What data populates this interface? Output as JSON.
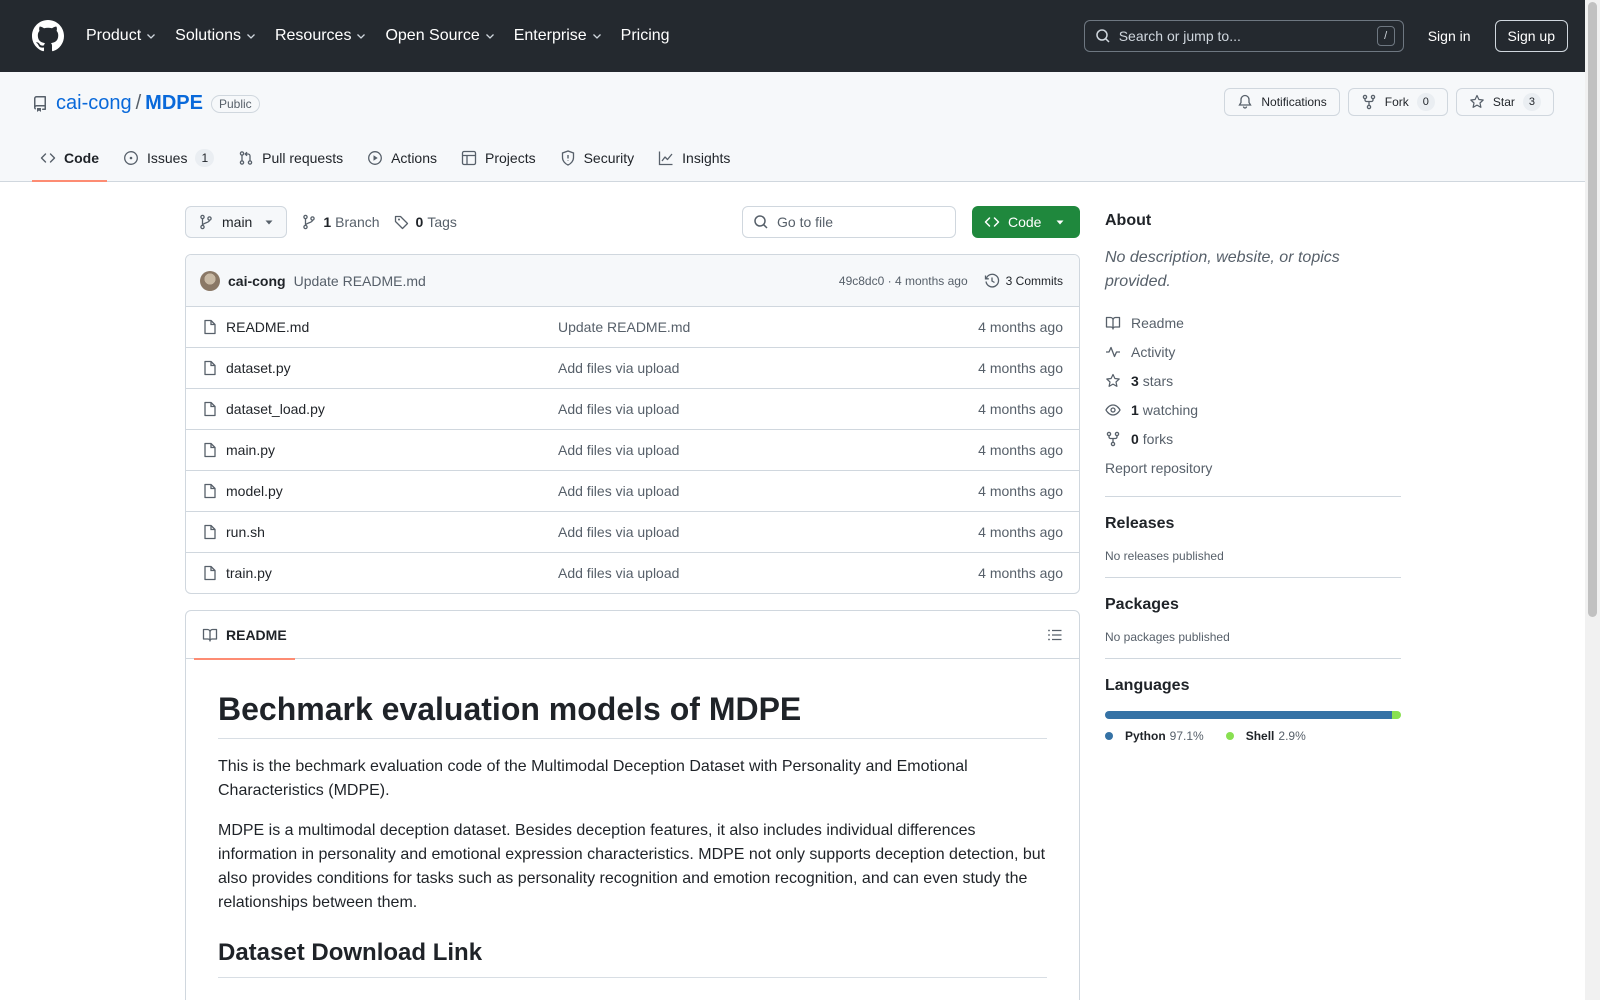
{
  "header": {
    "nav": [
      "Product",
      "Solutions",
      "Resources",
      "Open Source",
      "Enterprise",
      "Pricing"
    ],
    "search_placeholder": "Search or jump to...",
    "search_shortcut": "/",
    "sign_in": "Sign in",
    "sign_up": "Sign up"
  },
  "repo": {
    "owner": "cai-cong",
    "separator": "/",
    "name": "MDPE",
    "visibility": "Public",
    "notifications_label": "Notifications",
    "fork_label": "Fork",
    "fork_count": "0",
    "star_label": "Star",
    "star_count": "3"
  },
  "tabs": [
    {
      "label": "Code",
      "icon": "code-icon"
    },
    {
      "label": "Issues",
      "icon": "issue-icon",
      "count": "1"
    },
    {
      "label": "Pull requests",
      "icon": "pull-request-icon"
    },
    {
      "label": "Actions",
      "icon": "play-icon"
    },
    {
      "label": "Projects",
      "icon": "table-icon"
    },
    {
      "label": "Security",
      "icon": "shield-icon"
    },
    {
      "label": "Insights",
      "icon": "graph-icon"
    }
  ],
  "toolbar": {
    "branch": "main",
    "branch_count": "1",
    "branch_label": "Branch",
    "tag_count": "0",
    "tag_label": "Tags",
    "goto_placeholder": "Go to file",
    "code_button": "Code"
  },
  "commit": {
    "author": "cai-cong",
    "message": "Update README.md",
    "meta": "49c8dc0 · 4 months ago",
    "commits_label": "3 Commits"
  },
  "files": [
    {
      "name": "README.md",
      "message": "Update README.md",
      "age": "4 months ago"
    },
    {
      "name": "dataset.py",
      "message": "Add files via upload",
      "age": "4 months ago"
    },
    {
      "name": "dataset_load.py",
      "message": "Add files via upload",
      "age": "4 months ago"
    },
    {
      "name": "main.py",
      "message": "Add files via upload",
      "age": "4 months ago"
    },
    {
      "name": "model.py",
      "message": "Add files via upload",
      "age": "4 months ago"
    },
    {
      "name": "run.sh",
      "message": "Add files via upload",
      "age": "4 months ago"
    },
    {
      "name": "train.py",
      "message": "Add files via upload",
      "age": "4 months ago"
    }
  ],
  "readme": {
    "tab_label": "README",
    "h1": "Bechmark evaluation models of MDPE",
    "p1": "This is the bechmark evaluation code of the Multimodal Deception Dataset with Personality and Emotional Characteristics (MDPE).",
    "p2": "MDPE is a multimodal deception dataset. Besides deception features, it also includes individual differences information in personality and emotional expression characteristics. MDPE not only supports deception detection, but also provides conditions for tasks such as personality recognition and emotion recognition, and can even study the relationships between them.",
    "h2": "Dataset Download Link"
  },
  "sidebar": {
    "about_title": "About",
    "about_desc": "No description, website, or topics provided.",
    "links": [
      {
        "icon": "book-icon",
        "bold": "",
        "text": "Readme"
      },
      {
        "icon": "pulse-icon",
        "bold": "",
        "text": "Activity"
      },
      {
        "icon": "star-icon",
        "bold": "3",
        "text": "stars"
      },
      {
        "icon": "eye-icon",
        "bold": "1",
        "text": "watching"
      },
      {
        "icon": "fork-icon",
        "bold": "0",
        "text": "forks"
      }
    ],
    "report": "Report repository",
    "releases_title": "Releases",
    "releases_text": "No releases published",
    "packages_title": "Packages",
    "packages_text": "No packages published",
    "languages_title": "Languages",
    "languages": [
      {
        "name": "Python",
        "percent": "97.1%",
        "share": 97.1,
        "color": "#3572A5"
      },
      {
        "name": "Shell",
        "percent": "2.9%",
        "share": 2.9,
        "color": "#89e051"
      }
    ]
  },
  "colors": {
    "header_bg": "#24292f",
    "link": "#0969da",
    "code_button": "#1f883d",
    "tab_underline": "#fd8c73"
  }
}
